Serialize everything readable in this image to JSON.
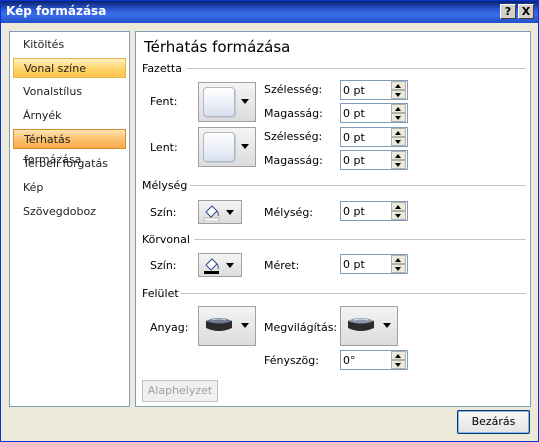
{
  "window": {
    "title": "Kép formázása",
    "help_label": "?",
    "close_label": "X"
  },
  "sidebar": {
    "items": [
      {
        "label": "Kitöltés"
      },
      {
        "label": "Vonal színe"
      },
      {
        "label": "Vonalstílus"
      },
      {
        "label": "Árnyék"
      },
      {
        "label": "Térhatás formázása"
      },
      {
        "label": "Térbeli forgatás"
      },
      {
        "label": "Kép"
      },
      {
        "label": "Szövegdoboz"
      }
    ]
  },
  "panel": {
    "title": "Térhatás formázása",
    "bevel": {
      "group_label": "Fazetta",
      "top_label": "Fent:",
      "bottom_label": "Lent:",
      "width_label": "Szélesség:",
      "height_label": "Magasság:",
      "top_width": "0 pt",
      "top_height": "0 pt",
      "bottom_width": "0 pt",
      "bottom_height": "0 pt"
    },
    "depth": {
      "group_label": "Mélység",
      "color_label": "Szín:",
      "depth_label": "Mélység:",
      "depth_value": "0 pt"
    },
    "contour": {
      "group_label": "Körvonal",
      "color_label": "Szín:",
      "size_label": "Méret:",
      "size_value": "0 pt"
    },
    "surface": {
      "group_label": "Felület",
      "material_label": "Anyag:",
      "lighting_label": "Megvilágítás:",
      "angle_label": "Fényszög:",
      "angle_value": "0°"
    },
    "reset_label": "Alaphelyzet"
  },
  "footer": {
    "close_label": "Bezárás"
  },
  "colors": {
    "title_bar": "#2c5ad8",
    "selected_item": "#ffd36a",
    "active_item": "#fbbf6a"
  }
}
